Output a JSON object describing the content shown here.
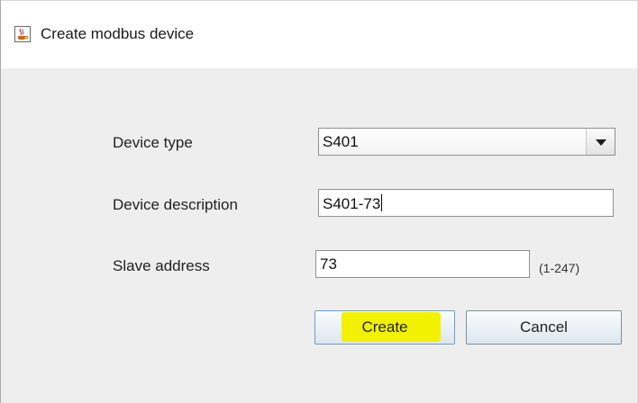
{
  "window": {
    "title": "Create modbus device",
    "icon": "java-cup-icon"
  },
  "form": {
    "device_type": {
      "label": "Device type",
      "value": "S401"
    },
    "device_description": {
      "label": "Device description",
      "value": "S401-73"
    },
    "slave_address": {
      "label": "Slave address",
      "value": "73",
      "range_hint": "(1-247)"
    }
  },
  "buttons": {
    "create": "Create",
    "cancel": "Cancel"
  },
  "colors": {
    "highlight": "#f2f200",
    "panel_background": "#eeeeee"
  }
}
